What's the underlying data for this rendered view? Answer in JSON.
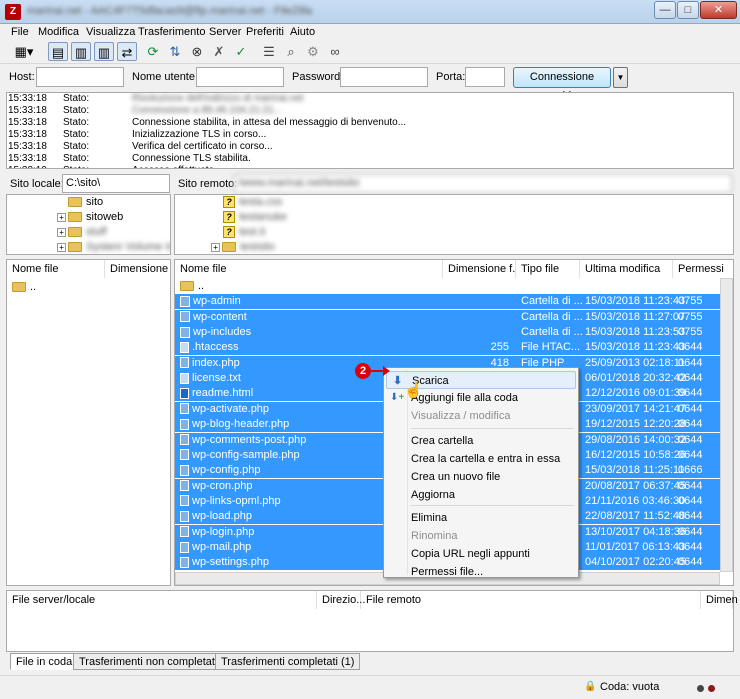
{
  "window": {
    "title_blurred": "marinai.net - AAC4F7T5dfacas9@ftp.marinai.net - FileZilla",
    "minimize": "—",
    "maximize": "□",
    "close": "✕"
  },
  "menu": [
    "File",
    "Modifica",
    "Visualizza",
    "Trasferimento",
    "Server",
    "Preferiti",
    "Aiuto"
  ],
  "quickconnect": {
    "host_label": "Host:",
    "user_label": "Nome utente:",
    "pass_label": "Password:",
    "port_label": "Porta:",
    "button": "Connessione rapida",
    "dropdown": "▼"
  },
  "log": [
    {
      "time": "15:33:18",
      "type": "Stato:",
      "msg": "Risoluzione dell'indirizzo di marinai.net",
      "blurred": true
    },
    {
      "time": "15:33:18",
      "type": "Stato:",
      "msg": "Connessione a 89.46.104.21:21...",
      "blurred": true
    },
    {
      "time": "15:33:18",
      "type": "Stato:",
      "msg": "Connessione stabilita, in attesa del messaggio di benvenuto...",
      "blurred": false
    },
    {
      "time": "15:33:18",
      "type": "Stato:",
      "msg": "Inizializzazione TLS in corso...",
      "blurred": false
    },
    {
      "time": "15:33:18",
      "type": "Stato:",
      "msg": "Verifica del certificato in corso...",
      "blurred": false
    },
    {
      "time": "15:33:18",
      "type": "Stato:",
      "msg": "Connessione TLS stabilita.",
      "blurred": false
    },
    {
      "time": "15:33:19",
      "type": "Stato:",
      "msg": "Accesso effettuato",
      "blurred": false
    }
  ],
  "local": {
    "path_label": "Sito locale:",
    "path": "C:\\sito\\",
    "tree": [
      {
        "label": "sito",
        "blurred": false,
        "plus": false
      },
      {
        "label": "sitoweb",
        "blurred": false,
        "plus": true
      },
      {
        "label": "stuff",
        "blurred": true,
        "plus": true
      },
      {
        "label": "System Volume Inf",
        "blurred": true,
        "plus": true
      }
    ],
    "col_name": "Nome file",
    "col_size": "Dimensione",
    "files": [
      ".."
    ]
  },
  "remote": {
    "path_label": "Sito remoto:",
    "path": "/www.marinai.net/testsito",
    "tree": [
      {
        "label": "testa.css",
        "plus": false
      },
      {
        "label": "testanuke",
        "plus": false
      },
      {
        "label": "test.it",
        "plus": false
      },
      {
        "label": "testsito",
        "plus": true
      }
    ],
    "columns": [
      "Nome file",
      "Dimensione f...",
      "Tipo file",
      "Ultima modifica",
      "Permessi"
    ],
    "files": [
      {
        "name": "..",
        "size": "",
        "type": "",
        "date": "",
        "perm": "",
        "icon": "folder",
        "sel": false
      },
      {
        "name": "wp-admin",
        "size": "",
        "type": "Cartella di ...",
        "date": "15/03/2018 11:23:43",
        "perm": "0755",
        "icon": "fold",
        "sel": true
      },
      {
        "name": "wp-content",
        "size": "",
        "type": "Cartella di ...",
        "date": "15/03/2018 11:27:07",
        "perm": "0755",
        "icon": "fold",
        "sel": true
      },
      {
        "name": "wp-includes",
        "size": "",
        "type": "Cartella di ...",
        "date": "15/03/2018 11:23:53",
        "perm": "0755",
        "icon": "fold",
        "sel": true
      },
      {
        "name": ".htaccess",
        "size": "255",
        "type": "File HTAC...",
        "date": "15/03/2018 11:23:43",
        "perm": "0644",
        "icon": "file",
        "sel": true
      },
      {
        "name": "index.php",
        "size": "418",
        "type": "File PHP",
        "date": "25/09/2013 02:18:11",
        "perm": "0644",
        "icon": "php",
        "sel": true
      },
      {
        "name": "license.txt",
        "size": "",
        "type": "",
        "date": "06/01/2018 20:32:42",
        "perm": "0644",
        "icon": "file",
        "sel": true
      },
      {
        "name": "readme.html",
        "size": "",
        "type": "",
        "date": "12/12/2016 09:01:39",
        "perm": "0644",
        "icon": "html",
        "sel": true
      },
      {
        "name": "wp-activate.php",
        "size": "",
        "type": "",
        "date": "23/09/2017 14:21:47",
        "perm": "0644",
        "icon": "php",
        "sel": true
      },
      {
        "name": "wp-blog-header.php",
        "size": "",
        "type": "",
        "date": "19/12/2015 12:20:28",
        "perm": "0644",
        "icon": "php",
        "sel": true
      },
      {
        "name": "wp-comments-post.php",
        "size": "",
        "type": "",
        "date": "29/08/2016 14:00:32",
        "perm": "0644",
        "icon": "php",
        "sel": true
      },
      {
        "name": "wp-config-sample.php",
        "size": "",
        "type": "",
        "date": "16/12/2015 10:58:26",
        "perm": "0644",
        "icon": "php",
        "sel": true
      },
      {
        "name": "wp-config.php",
        "size": "",
        "type": "",
        "date": "15/03/2018 11:25:11",
        "perm": "0666",
        "icon": "php",
        "sel": true
      },
      {
        "name": "wp-cron.php",
        "size": "",
        "type": "",
        "date": "20/08/2017 06:37:45",
        "perm": "0644",
        "icon": "php",
        "sel": true
      },
      {
        "name": "wp-links-opml.php",
        "size": "",
        "type": "",
        "date": "21/11/2016 03:46:30",
        "perm": "0644",
        "icon": "php",
        "sel": true
      },
      {
        "name": "wp-load.php",
        "size": "",
        "type": "",
        "date": "22/08/2017 11:52:48",
        "perm": "0644",
        "icon": "php",
        "sel": true
      },
      {
        "name": "wp-login.php",
        "size": "",
        "type": "",
        "date": "13/10/2017 04:18:36",
        "perm": "0644",
        "icon": "php",
        "sel": true
      },
      {
        "name": "wp-mail.php",
        "size": "",
        "type": "",
        "date": "11/01/2017 06:13:43",
        "perm": "0644",
        "icon": "php",
        "sel": true
      },
      {
        "name": "wp-settings.php",
        "size": "",
        "type": "",
        "date": "04/10/2017 02:20:45",
        "perm": "0644",
        "icon": "php",
        "sel": true
      }
    ]
  },
  "context_menu": {
    "items": [
      {
        "label": "Scarica",
        "icon": "download-arrow",
        "disabled": false,
        "highlight": true
      },
      {
        "label": "Aggiungi file alla coda",
        "icon": "queue-arrow",
        "disabled": false,
        "highlight": false
      },
      {
        "label": "Visualizza / modifica",
        "disabled": true,
        "highlight": false
      },
      {
        "label": "Crea cartella",
        "disabled": false,
        "highlight": false
      },
      {
        "label": "Crea la cartella e entra in essa",
        "disabled": false,
        "highlight": false
      },
      {
        "label": "Crea un nuovo file",
        "disabled": false,
        "highlight": false
      },
      {
        "label": "Aggiorna",
        "disabled": false,
        "highlight": false
      },
      {
        "label": "Elimina",
        "disabled": false,
        "highlight": false
      },
      {
        "label": "Rinomina",
        "disabled": true,
        "highlight": false
      },
      {
        "label": "Copia URL negli appunti",
        "disabled": false,
        "highlight": false
      },
      {
        "label": "Permessi file...",
        "disabled": false,
        "highlight": false
      }
    ],
    "annotation": "2"
  },
  "queue": {
    "columns": [
      "File server/locale",
      "Direzio...",
      "File remoto",
      "Dimen"
    ]
  },
  "tabs": [
    "File in coda",
    "Trasferimenti non completati",
    "Trasferimenti completati (1)"
  ],
  "status": {
    "queue": "Coda: vuota"
  },
  "colors": {
    "selection": "#3399ff",
    "annotation": "#d9000d",
    "folder": "#e8c25a"
  }
}
